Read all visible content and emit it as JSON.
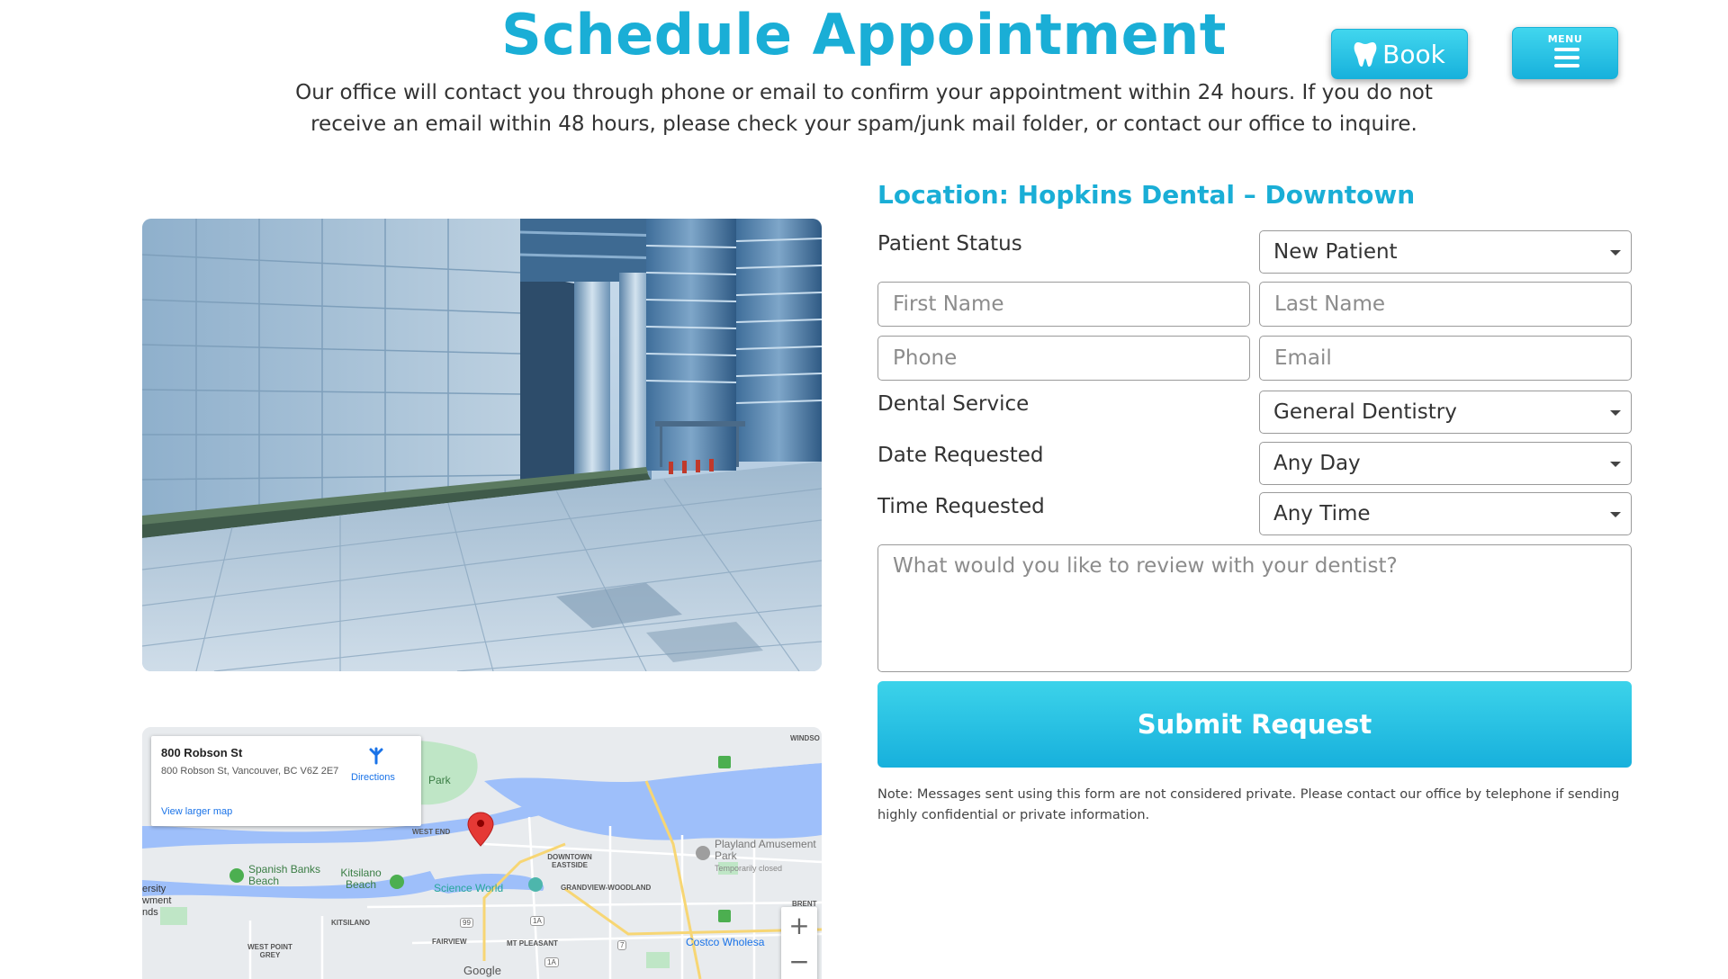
{
  "header": {
    "title": "Schedule Appointment",
    "intro": "Our office will contact you through phone or email to confirm your appointment within 24 hours. If you do not receive an email within 48 hours, please check your spam/junk mail folder, or contact our office to inquire.",
    "book_label": "Book",
    "menu_label": "MENU"
  },
  "map": {
    "card_title": "800 Robson St",
    "card_address": "800 Robson St, Vancouver, BC V6Z 2E7",
    "directions_label": "Directions",
    "view_larger_label": "View larger map",
    "labels": {
      "park": "Park",
      "west_end": "WEST END",
      "downtown_eastside": "DOWNTOWN EASTSIDE",
      "playland": "Playland Amusement Park",
      "temporarily_closed": "Temporarily closed",
      "spanish_banks": "Spanish Banks Beach",
      "kitsilano_beach": "Kitsilano Beach",
      "science_world": "Science World",
      "grandview": "GRANDVIEW-WOODLAND",
      "kitsilano": "KITSILANO",
      "west_point_grey": "WEST POINT GREY",
      "fairview": "FAIRVIEW",
      "mt_pleasant": "MT PLEASANT",
      "costco": "Costco Wholesa",
      "brent": "BRENT",
      "windso": "WINDSO",
      "ersity": "ersity",
      "wment": "wment",
      "nds": "nds",
      "google": "Google",
      "hw_99": "99",
      "hw_1a": "1A",
      "hw_7": "7",
      "hw_1a_b": "1A"
    },
    "zoom_in": "+",
    "zoom_out": "−",
    "colors": {
      "water": "#9ebffa",
      "land": "#e8ebee",
      "park": "#bfe6c6",
      "pin": "#e53935"
    }
  },
  "form": {
    "location_title": "Location: Hopkins Dental – Downtown",
    "patient_status_label": "Patient Status",
    "patient_status_value": "New Patient",
    "first_name_placeholder": "First Name",
    "last_name_placeholder": "Last Name",
    "phone_placeholder": "Phone",
    "email_placeholder": "Email",
    "dental_service_label": "Dental Service",
    "dental_service_value": "General Dentistry",
    "date_label": "Date Requested",
    "date_value": "Any Day",
    "time_label": "Time Requested",
    "time_value": "Any Time",
    "message_placeholder": "What would you like to review with your dentist?",
    "submit_label": "Submit Request",
    "note": "Note: Messages sent using this form are not considered private. Please contact our office by telephone if sending highly confidential or private information."
  },
  "theme": {
    "accent": "#1aaed6",
    "accent_light": "#41d6ee"
  }
}
